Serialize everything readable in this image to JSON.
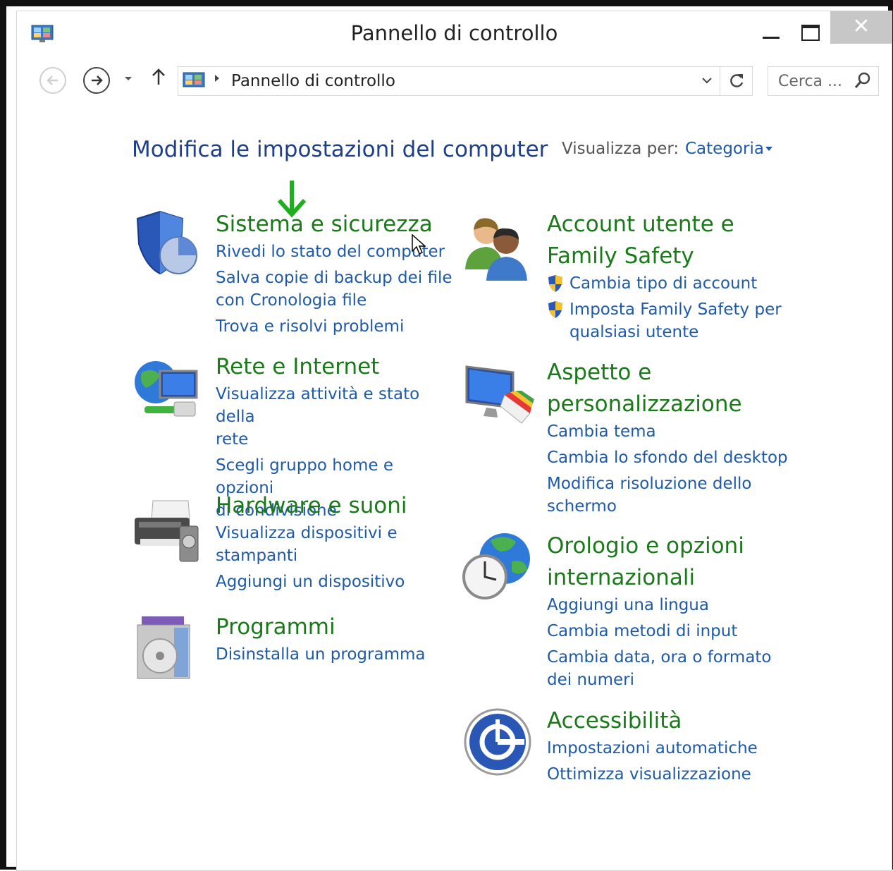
{
  "window": {
    "title": "Pannello di controllo",
    "minimize_glyph": "",
    "maximize_glyph": "",
    "close_glyph": "✕"
  },
  "nav": {
    "breadcrumb": "Pannello di controllo",
    "search_placeholder": "Cerca ..."
  },
  "header": {
    "title": "Modifica le impostazioni del computer",
    "view_by_label": "Visualizza per:",
    "view_by_value": "Categoria"
  },
  "categories_left": [
    {
      "title": [
        "Sistema e sicurezza"
      ],
      "icon": "shield-icon",
      "links": [
        [
          "Rivedi lo stato del computer"
        ],
        [
          "Salva copie di backup dei file",
          "con Cronologia file"
        ],
        [
          "Trova e risolvi problemi"
        ]
      ]
    },
    {
      "title": [
        "Rete e Internet"
      ],
      "icon": "network-globe-icon",
      "links": [
        [
          "Visualizza attività e stato della",
          "rete"
        ],
        [
          "Scegli gruppo home e opzioni",
          "di condivisione"
        ]
      ]
    },
    {
      "title": [
        "Hardware e suoni"
      ],
      "icon": "printer-icon",
      "links": [
        [
          "Visualizza dispositivi e",
          "stampanti"
        ],
        [
          "Aggiungi un dispositivo"
        ]
      ]
    },
    {
      "title": [
        "Programmi"
      ],
      "icon": "programs-disc-icon",
      "links": [
        [
          "Disinstalla un programma"
        ]
      ]
    }
  ],
  "categories_right": [
    {
      "title": [
        "Account utente e",
        "Family Safety"
      ],
      "icon": "users-icon",
      "links": [
        [
          "Cambia tipo di account"
        ],
        [
          "Imposta Family Safety per",
          "qualsiasi utente"
        ]
      ]
    },
    {
      "title": [
        "Aspetto e",
        "personalizzazione"
      ],
      "icon": "monitor-palette-icon",
      "links": [
        [
          "Cambia tema"
        ],
        [
          "Cambia lo sfondo del desktop"
        ],
        [
          "Modifica risoluzione dello",
          "schermo"
        ]
      ]
    },
    {
      "title": [
        "Orologio e opzioni",
        "internazionali"
      ],
      "icon": "clock-globe-icon",
      "links": [
        [
          "Aggiungi una lingua"
        ],
        [
          "Cambia metodi di input"
        ],
        [
          "Cambia data, ora o formato",
          "dei numeri"
        ]
      ]
    },
    {
      "title": [
        "Accessibilità"
      ],
      "icon": "accessibility-icon",
      "links": [
        [
          "Impostazioni automatiche"
        ],
        [
          "Ottimizza visualizzazione"
        ]
      ]
    }
  ]
}
